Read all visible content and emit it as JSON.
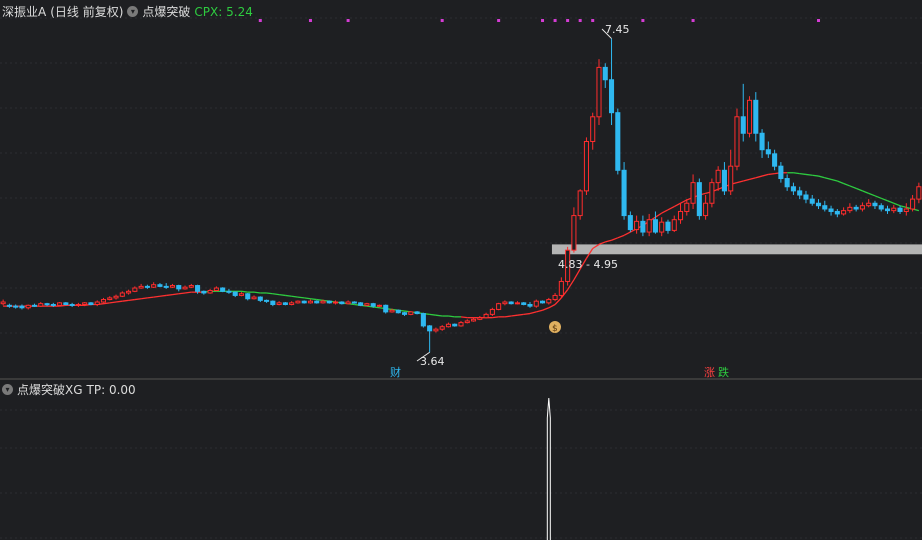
{
  "header": {
    "stock_name": "深振业A",
    "period": "(日线 前复权)",
    "indicator": "点爆突破",
    "cpx_label": "CPX: 5.24"
  },
  "sub_header": {
    "indicator": "点爆突破XG",
    "tp_label": "TP: 0.00"
  },
  "annotations": {
    "high_price": "7.45",
    "low_price": "3.64",
    "range_label": "4.83 - 4.95",
    "cai_tag": "财",
    "zhang_tag": "涨",
    "die_tag": "跌",
    "money_bag": "$"
  },
  "colors": {
    "up": "#ff2d2d",
    "down": "#2fb8f0",
    "ma_up": "#ff3030",
    "ma_down": "#2ecc40",
    "signal_dot": "#d43cd4",
    "band": "#b4b4b4",
    "signal": "#ffffff"
  },
  "chart_data": {
    "type": "candlestick",
    "ylim": [
      3.4,
      7.7
    ],
    "band": [
      4.83,
      4.95
    ],
    "candles": [
      [
        4.23,
        4.25,
        4.21,
        4.28
      ],
      [
        4.21,
        4.2,
        4.18,
        4.23
      ],
      [
        4.2,
        4.19,
        4.17,
        4.22
      ],
      [
        4.2,
        4.18,
        4.16,
        4.22
      ],
      [
        4.18,
        4.21,
        4.16,
        4.22
      ],
      [
        4.21,
        4.2,
        4.19,
        4.23
      ],
      [
        4.2,
        4.23,
        4.19,
        4.25
      ],
      [
        4.23,
        4.22,
        4.2,
        4.24
      ],
      [
        4.22,
        4.21,
        4.19,
        4.24
      ],
      [
        4.21,
        4.24,
        4.2,
        4.25
      ],
      [
        4.24,
        4.22,
        4.21,
        4.25
      ],
      [
        4.22,
        4.21,
        4.19,
        4.24
      ],
      [
        4.21,
        4.22,
        4.19,
        4.24
      ],
      [
        4.22,
        4.24,
        4.2,
        4.25
      ],
      [
        4.24,
        4.22,
        4.21,
        4.25
      ],
      [
        4.22,
        4.25,
        4.2,
        4.27
      ],
      [
        4.25,
        4.28,
        4.24,
        4.3
      ],
      [
        4.28,
        4.3,
        4.27,
        4.32
      ],
      [
        4.3,
        4.32,
        4.28,
        4.34
      ],
      [
        4.32,
        4.36,
        4.31,
        4.38
      ],
      [
        4.36,
        4.38,
        4.34,
        4.4
      ],
      [
        4.38,
        4.42,
        4.37,
        4.44
      ],
      [
        4.42,
        4.44,
        4.41,
        4.47
      ],
      [
        4.44,
        4.43,
        4.41,
        4.46
      ],
      [
        4.43,
        4.46,
        4.42,
        4.49
      ],
      [
        4.46,
        4.44,
        4.43,
        4.48
      ],
      [
        4.44,
        4.43,
        4.41,
        4.48
      ],
      [
        4.43,
        4.45,
        4.42,
        4.47
      ],
      [
        4.45,
        4.41,
        4.38,
        4.46
      ],
      [
        4.41,
        4.43,
        4.4,
        4.45
      ],
      [
        4.43,
        4.45,
        4.42,
        4.47
      ],
      [
        4.45,
        4.38,
        4.35,
        4.46
      ],
      [
        4.38,
        4.36,
        4.34,
        4.39
      ],
      [
        4.36,
        4.39,
        4.35,
        4.41
      ],
      [
        4.39,
        4.42,
        4.38,
        4.44
      ],
      [
        4.42,
        4.38,
        4.37,
        4.43
      ],
      [
        4.38,
        4.37,
        4.35,
        4.41
      ],
      [
        4.37,
        4.33,
        4.31,
        4.38
      ],
      [
        4.33,
        4.35,
        4.32,
        4.37
      ],
      [
        4.35,
        4.29,
        4.27,
        4.36
      ],
      [
        4.29,
        4.31,
        4.28,
        4.33
      ],
      [
        4.31,
        4.27,
        4.25,
        4.32
      ],
      [
        4.27,
        4.26,
        4.24,
        4.28
      ],
      [
        4.26,
        4.22,
        4.2,
        4.27
      ],
      [
        4.22,
        4.24,
        4.21,
        4.26
      ],
      [
        4.24,
        4.22,
        4.21,
        4.25
      ],
      [
        4.22,
        4.24,
        4.21,
        4.26
      ],
      [
        4.24,
        4.26,
        4.23,
        4.27
      ],
      [
        4.26,
        4.24,
        4.23,
        4.27
      ],
      [
        4.24,
        4.26,
        4.23,
        4.28
      ],
      [
        4.26,
        4.24,
        4.23,
        4.27
      ],
      [
        4.24,
        4.26,
        4.23,
        4.28
      ],
      [
        4.26,
        4.24,
        4.23,
        4.27
      ],
      [
        4.24,
        4.25,
        4.22,
        4.27
      ],
      [
        4.25,
        4.23,
        4.22,
        4.26
      ],
      [
        4.23,
        4.25,
        4.22,
        4.27
      ],
      [
        4.25,
        4.24,
        4.23,
        4.26
      ],
      [
        4.24,
        4.21,
        4.2,
        4.25
      ],
      [
        4.21,
        4.23,
        4.2,
        4.24
      ],
      [
        4.23,
        4.2,
        4.18,
        4.24
      ],
      [
        4.2,
        4.21,
        4.19,
        4.22
      ],
      [
        4.21,
        4.13,
        4.11,
        4.22
      ],
      [
        4.13,
        4.15,
        4.12,
        4.17
      ],
      [
        4.15,
        4.12,
        4.11,
        4.16
      ],
      [
        4.12,
        4.1,
        4.08,
        4.13
      ],
      [
        4.1,
        4.13,
        4.09,
        4.14
      ],
      [
        4.13,
        4.11,
        4.1,
        4.14
      ],
      [
        4.11,
        3.96,
        3.94,
        4.12
      ],
      [
        3.96,
        3.9,
        3.64,
        3.97
      ],
      [
        3.9,
        3.92,
        3.88,
        3.94
      ],
      [
        3.92,
        3.95,
        3.9,
        3.97
      ],
      [
        3.95,
        3.98,
        3.94,
        4.0
      ],
      [
        3.98,
        3.96,
        3.95,
        3.99
      ],
      [
        3.96,
        4.0,
        3.95,
        4.02
      ],
      [
        4.0,
        4.02,
        3.99,
        4.04
      ],
      [
        4.02,
        4.04,
        4.01,
        4.06
      ],
      [
        4.04,
        4.06,
        4.03,
        4.08
      ],
      [
        4.06,
        4.1,
        4.05,
        4.12
      ],
      [
        4.1,
        4.16,
        4.08,
        4.18
      ],
      [
        4.16,
        4.23,
        4.15,
        4.24
      ],
      [
        4.23,
        4.25,
        4.21,
        4.27
      ],
      [
        4.25,
        4.23,
        4.22,
        4.26
      ],
      [
        4.23,
        4.24,
        4.22,
        4.26
      ],
      [
        4.24,
        4.22,
        4.21,
        4.25
      ],
      [
        4.22,
        4.2,
        4.18,
        4.25
      ],
      [
        4.2,
        4.26,
        4.18,
        4.28
      ],
      [
        4.26,
        4.24,
        4.23,
        4.27
      ],
      [
        4.24,
        4.28,
        4.22,
        4.3
      ],
      [
        4.28,
        4.33,
        4.26,
        4.36
      ],
      [
        4.33,
        4.5,
        4.3,
        4.55
      ],
      [
        4.5,
        4.88,
        4.45,
        4.92
      ],
      [
        4.88,
        5.3,
        4.85,
        5.4
      ],
      [
        5.3,
        5.6,
        5.25,
        5.62
      ],
      [
        5.6,
        6.2,
        5.55,
        6.25
      ],
      [
        6.2,
        6.5,
        6.1,
        6.55
      ],
      [
        6.5,
        7.1,
        6.4,
        7.2
      ],
      [
        7.1,
        6.95,
        6.85,
        7.15
      ],
      [
        6.95,
        6.55,
        6.4,
        7.45
      ],
      [
        6.55,
        5.85,
        5.8,
        6.6
      ],
      [
        5.85,
        5.3,
        5.25,
        5.95
      ],
      [
        5.3,
        5.13,
        5.1,
        5.35
      ],
      [
        5.13,
        5.23,
        5.08,
        5.3
      ],
      [
        5.23,
        5.1,
        5.05,
        5.3
      ],
      [
        5.1,
        5.25,
        5.05,
        5.32
      ],
      [
        5.25,
        5.1,
        5.08,
        5.35
      ],
      [
        5.1,
        5.22,
        5.05,
        5.28
      ],
      [
        5.22,
        5.12,
        5.08,
        5.25
      ],
      [
        5.12,
        5.25,
        5.1,
        5.3
      ],
      [
        5.25,
        5.35,
        5.2,
        5.45
      ],
      [
        5.35,
        5.45,
        5.3,
        5.5
      ],
      [
        5.45,
        5.7,
        5.38,
        5.8
      ],
      [
        5.7,
        5.3,
        5.25,
        5.75
      ],
      [
        5.3,
        5.45,
        5.25,
        5.55
      ],
      [
        5.45,
        5.7,
        5.4,
        5.75
      ],
      [
        5.7,
        5.85,
        5.6,
        5.9
      ],
      [
        5.85,
        5.6,
        5.55,
        5.95
      ],
      [
        5.6,
        5.9,
        5.55,
        6.1
      ],
      [
        5.9,
        6.5,
        5.85,
        6.6
      ],
      [
        6.5,
        6.3,
        6.2,
        6.9
      ],
      [
        6.3,
        6.7,
        6.25,
        6.75
      ],
      [
        6.7,
        6.3,
        6.2,
        6.8
      ],
      [
        6.3,
        6.1,
        6.0,
        6.35
      ],
      [
        6.1,
        6.05,
        6.0,
        6.2
      ],
      [
        6.05,
        5.9,
        5.85,
        6.1
      ],
      [
        5.9,
        5.75,
        5.7,
        5.95
      ],
      [
        5.75,
        5.65,
        5.6,
        5.8
      ],
      [
        5.65,
        5.6,
        5.55,
        5.7
      ],
      [
        5.6,
        5.55,
        5.5,
        5.65
      ],
      [
        5.55,
        5.5,
        5.45,
        5.6
      ],
      [
        5.5,
        5.45,
        5.42,
        5.55
      ],
      [
        5.45,
        5.42,
        5.38,
        5.5
      ],
      [
        5.42,
        5.38,
        5.35,
        5.48
      ],
      [
        5.38,
        5.35,
        5.3,
        5.42
      ],
      [
        5.35,
        5.32,
        5.28,
        5.38
      ],
      [
        5.32,
        5.36,
        5.3,
        5.4
      ],
      [
        5.36,
        5.4,
        5.33,
        5.45
      ],
      [
        5.4,
        5.38,
        5.35,
        5.43
      ],
      [
        5.38,
        5.42,
        5.35,
        5.46
      ],
      [
        5.42,
        5.45,
        5.4,
        5.5
      ],
      [
        5.45,
        5.42,
        5.38,
        5.48
      ],
      [
        5.42,
        5.38,
        5.35,
        5.45
      ],
      [
        5.38,
        5.36,
        5.32,
        5.42
      ],
      [
        5.36,
        5.39,
        5.33,
        5.43
      ],
      [
        5.39,
        5.35,
        5.32,
        5.42
      ],
      [
        5.35,
        5.38,
        5.3,
        5.45
      ],
      [
        5.38,
        5.5,
        5.35,
        5.55
      ],
      [
        5.5,
        5.65,
        5.45,
        5.7
      ]
    ],
    "ma": [
      4.2,
      4.2,
      4.2,
      4.2,
      4.2,
      4.2,
      4.2,
      4.2,
      4.2,
      4.2,
      4.21,
      4.21,
      4.21,
      4.21,
      4.22,
      4.22,
      4.23,
      4.24,
      4.25,
      4.26,
      4.27,
      4.28,
      4.29,
      4.3,
      4.31,
      4.32,
      4.33,
      4.34,
      4.35,
      4.36,
      4.37,
      4.37,
      4.37,
      4.38,
      4.38,
      4.38,
      4.38,
      4.38,
      4.38,
      4.37,
      4.37,
      4.36,
      4.36,
      4.35,
      4.34,
      4.33,
      4.32,
      4.31,
      4.3,
      4.29,
      4.28,
      4.27,
      4.26,
      4.25,
      4.24,
      4.23,
      4.22,
      4.21,
      4.2,
      4.19,
      4.18,
      4.17,
      4.16,
      4.15,
      4.14,
      4.13,
      4.12,
      4.11,
      4.1,
      4.09,
      4.08,
      4.08,
      4.07,
      4.07,
      4.06,
      4.06,
      4.06,
      4.06,
      4.06,
      4.07,
      4.07,
      4.08,
      4.09,
      4.1,
      4.11,
      4.13,
      4.15,
      4.18,
      4.22,
      4.3,
      4.4,
      4.52,
      4.65,
      4.78,
      4.9,
      4.95,
      4.98,
      5.0,
      5.03,
      5.06,
      5.1,
      5.14,
      5.18,
      5.23,
      5.28,
      5.33,
      5.37,
      5.41,
      5.45,
      5.49,
      5.52,
      5.55,
      5.57,
      5.59,
      5.62,
      5.65,
      5.68,
      5.7,
      5.72,
      5.74,
      5.76,
      5.78,
      5.8,
      5.81,
      5.82,
      5.82,
      5.82,
      5.81,
      5.8,
      5.79,
      5.78,
      5.76,
      5.74,
      5.72,
      5.69,
      5.66,
      5.63,
      5.6,
      5.57,
      5.54,
      5.51,
      5.48,
      5.45,
      5.42,
      5.4,
      5.38,
      5.36,
      5.35,
      5.34,
      5.34,
      5.35
    ],
    "ma_trend": [
      "up",
      "up",
      "up",
      "up",
      "up",
      "up",
      "up",
      "up",
      "up",
      "up",
      "up",
      "up",
      "up",
      "up",
      "up",
      "up",
      "up",
      "up",
      "up",
      "up",
      "up",
      "up",
      "up",
      "up",
      "up",
      "up",
      "up",
      "up",
      "up",
      "up",
      "up",
      "up",
      "up",
      "down",
      "down",
      "down",
      "down",
      "down",
      "down",
      "down",
      "down",
      "down",
      "down",
      "down",
      "down",
      "down",
      "down",
      "down",
      "down",
      "down",
      "down",
      "down",
      "down",
      "down",
      "down",
      "down",
      "down",
      "down",
      "down",
      "down",
      "down",
      "down",
      "down",
      "down",
      "down",
      "down",
      "down",
      "down",
      "down",
      "down",
      "down",
      "down",
      "down",
      "down",
      "up",
      "up",
      "up",
      "up",
      "up",
      "up",
      "up",
      "up",
      "up",
      "up",
      "up",
      "up",
      "up",
      "up",
      "up",
      "up",
      "up",
      "up",
      "up",
      "up",
      "up",
      "up",
      "up",
      "up",
      "up",
      "up",
      "up",
      "up",
      "up",
      "up",
      "up",
      "up",
      "up",
      "up",
      "up",
      "up",
      "up",
      "up",
      "up",
      "up",
      "up",
      "up",
      "up",
      "up",
      "up",
      "up",
      "up",
      "up",
      "up",
      "up",
      "up",
      "up",
      "down",
      "down",
      "down",
      "down",
      "down",
      "down",
      "down",
      "down",
      "down",
      "down",
      "down",
      "down",
      "down",
      "down",
      "down",
      "down",
      "down",
      "down",
      "down",
      "down",
      "down",
      "down",
      "up",
      "up"
    ],
    "signal_dots": [
      41,
      49,
      55,
      70,
      79,
      86,
      88,
      90,
      92,
      94,
      102,
      110,
      130
    ],
    "tp_signal": [
      [
        87,
        1.0
      ]
    ]
  }
}
